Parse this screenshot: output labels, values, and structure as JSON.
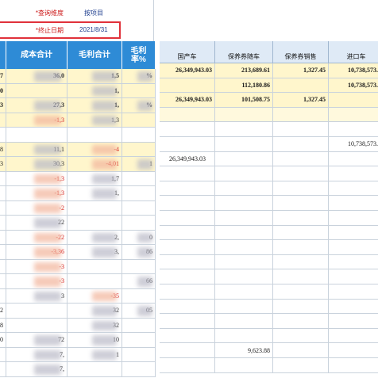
{
  "criteria": {
    "query_dim_label": "*查询维度",
    "query_dim_value": "按项目",
    "end_date_label": "*终止日期",
    "end_date_value": "2021/8/31"
  },
  "left_headers": [
    "成本合计",
    "毛利合计",
    "毛利率%"
  ],
  "right_headers": [
    "国产车",
    "保养券随车",
    "保养券销售",
    "进口车"
  ],
  "left_rows": [
    [
      "7",
      "36,0",
      "1,5",
      "%"
    ],
    [
      "0",
      "",
      "1,",
      ""
    ],
    [
      "3",
      "27,3",
      "1,",
      "%"
    ],
    [
      "",
      "-1,3",
      "1,3",
      ""
    ],
    [
      "",
      "",
      "",
      ""
    ],
    [
      "8",
      "11,1",
      "-4",
      ""
    ],
    [
      "3",
      "30,3",
      "-4,01",
      "1"
    ],
    [
      "",
      "-1,3",
      "1,7",
      ""
    ],
    [
      "",
      "-1,3",
      "1,",
      ""
    ],
    [
      "",
      "-2",
      "",
      ""
    ],
    [
      "",
      "22",
      "",
      ""
    ],
    [
      "",
      "-22",
      "2,",
      "0"
    ],
    [
      "",
      "-3,36",
      "3,",
      "86"
    ],
    [
      "",
      "-3",
      "",
      ""
    ],
    [
      "",
      "-3",
      "",
      "66"
    ],
    [
      "",
      "3",
      "-35",
      ""
    ],
    [
      "2",
      "",
      "32",
      "05"
    ],
    [
      "8",
      "",
      "32",
      ""
    ],
    [
      "0",
      "72",
      "10",
      ""
    ],
    [
      "",
      "7,",
      "1",
      ""
    ],
    [
      "",
      "7,",
      "",
      ""
    ]
  ],
  "right_rows": [
    [
      "26,349,943.03",
      "213,689.61",
      "1,327.45",
      "10,738,573.6"
    ],
    [
      "",
      "112,180.86",
      "",
      "10,738,573.6"
    ],
    [
      "26,349,943.03",
      "101,508.75",
      "1,327.45",
      ""
    ],
    [
      "",
      "",
      "",
      ""
    ],
    [
      "",
      "",
      "",
      ""
    ],
    [
      "",
      "",
      "",
      "10,738,573.6"
    ],
    [
      "26,349,943.03",
      "",
      "",
      ""
    ],
    [
      "",
      "",
      "",
      ""
    ],
    [
      "",
      "",
      "",
      ""
    ],
    [
      "",
      "",
      "",
      ""
    ],
    [
      "",
      "",
      "",
      ""
    ],
    [
      "",
      "",
      "",
      ""
    ],
    [
      "",
      "",
      "",
      ""
    ],
    [
      "",
      "",
      "",
      ""
    ],
    [
      "",
      "",
      "",
      ""
    ],
    [
      "",
      "",
      "",
      ""
    ],
    [
      "",
      "",
      "",
      ""
    ],
    [
      "",
      "",
      "",
      ""
    ],
    [
      "",
      "",
      "",
      ""
    ],
    [
      "",
      "9,623.88",
      "",
      ""
    ],
    [
      "",
      "",
      "",
      ""
    ]
  ]
}
